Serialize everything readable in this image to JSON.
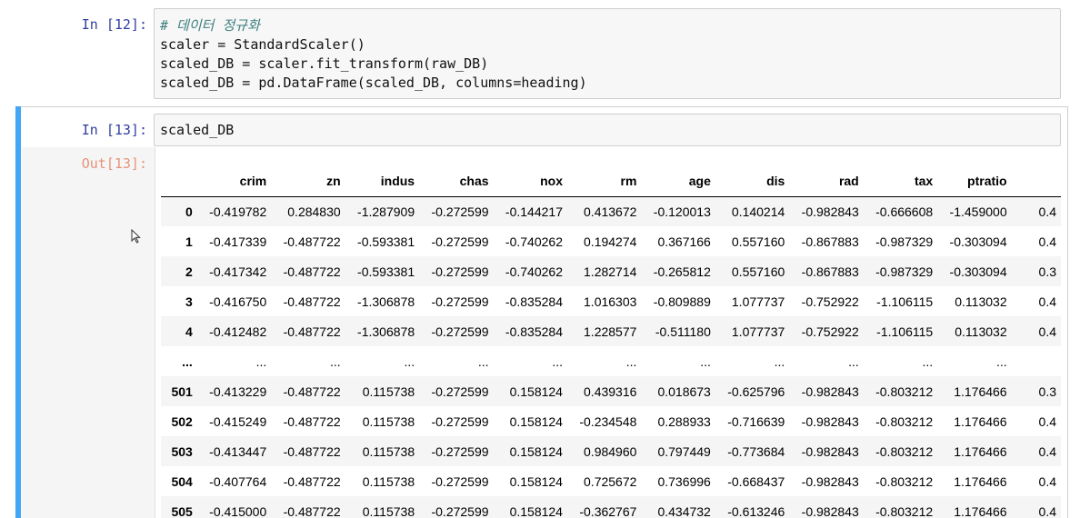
{
  "cell1": {
    "prompt": "In [12]:",
    "lines": [
      {
        "type": "comment",
        "text": "# 데이터 정규화"
      },
      {
        "type": "code",
        "text": "scaler = StandardScaler()"
      },
      {
        "type": "code",
        "text": "scaled_DB = scaler.fit_transform(raw_DB)"
      },
      {
        "type": "code",
        "text": "scaled_DB = pd.DataFrame(scaled_DB, columns=heading)"
      }
    ]
  },
  "cell2": {
    "prompt": "In [13]:",
    "code": "scaled_DB",
    "out_prompt": "Out[13]:"
  },
  "dataframe": {
    "columns": [
      "",
      "crim",
      "zn",
      "indus",
      "chas",
      "nox",
      "rm",
      "age",
      "dis",
      "rad",
      "tax",
      "ptratio",
      ""
    ],
    "rows": [
      {
        "index": "0",
        "values": [
          "-0.419782",
          "0.284830",
          "-1.287909",
          "-0.272599",
          "-0.144217",
          "0.413672",
          "-0.120013",
          "0.140214",
          "-0.982843",
          "-0.666608",
          "-1.459000",
          "0.4"
        ]
      },
      {
        "index": "1",
        "values": [
          "-0.417339",
          "-0.487722",
          "-0.593381",
          "-0.272599",
          "-0.740262",
          "0.194274",
          "0.367166",
          "0.557160",
          "-0.867883",
          "-0.987329",
          "-0.303094",
          "0.4"
        ]
      },
      {
        "index": "2",
        "values": [
          "-0.417342",
          "-0.487722",
          "-0.593381",
          "-0.272599",
          "-0.740262",
          "1.282714",
          "-0.265812",
          "0.557160",
          "-0.867883",
          "-0.987329",
          "-0.303094",
          "0.3"
        ]
      },
      {
        "index": "3",
        "values": [
          "-0.416750",
          "-0.487722",
          "-1.306878",
          "-0.272599",
          "-0.835284",
          "1.016303",
          "-0.809889",
          "1.077737",
          "-0.752922",
          "-1.106115",
          "0.113032",
          "0.4"
        ]
      },
      {
        "index": "4",
        "values": [
          "-0.412482",
          "-0.487722",
          "-1.306878",
          "-0.272599",
          "-0.835284",
          "1.228577",
          "-0.511180",
          "1.077737",
          "-0.752922",
          "-1.106115",
          "0.113032",
          "0.4"
        ]
      },
      {
        "index": "...",
        "values": [
          "...",
          "...",
          "...",
          "...",
          "...",
          "...",
          "...",
          "...",
          "...",
          "...",
          "...",
          ""
        ],
        "ellipsis": true
      },
      {
        "index": "501",
        "values": [
          "-0.413229",
          "-0.487722",
          "0.115738",
          "-0.272599",
          "0.158124",
          "0.439316",
          "0.018673",
          "-0.625796",
          "-0.982843",
          "-0.803212",
          "1.176466",
          "0.3"
        ]
      },
      {
        "index": "502",
        "values": [
          "-0.415249",
          "-0.487722",
          "0.115738",
          "-0.272599",
          "0.158124",
          "-0.234548",
          "0.288933",
          "-0.716639",
          "-0.982843",
          "-0.803212",
          "1.176466",
          "0.4"
        ]
      },
      {
        "index": "503",
        "values": [
          "-0.413447",
          "-0.487722",
          "0.115738",
          "-0.272599",
          "0.158124",
          "0.984960",
          "0.797449",
          "-0.773684",
          "-0.982843",
          "-0.803212",
          "1.176466",
          "0.4"
        ]
      },
      {
        "index": "504",
        "values": [
          "-0.407764",
          "-0.487722",
          "0.115738",
          "-0.272599",
          "0.158124",
          "0.725672",
          "0.736996",
          "-0.668437",
          "-0.982843",
          "-0.803212",
          "1.176466",
          "0.4"
        ]
      },
      {
        "index": "505",
        "values": [
          "-0.415000",
          "-0.487722",
          "0.115738",
          "-0.272599",
          "0.158124",
          "-0.362767",
          "0.434732",
          "-0.613246",
          "-0.982843",
          "-0.803212",
          "1.176466",
          "0.4"
        ]
      }
    ]
  },
  "colors": {
    "selected_cell_bar": "#42a5f5",
    "in_prompt": "#303f9f",
    "out_prompt": "#d84315",
    "comment": "#408080"
  }
}
